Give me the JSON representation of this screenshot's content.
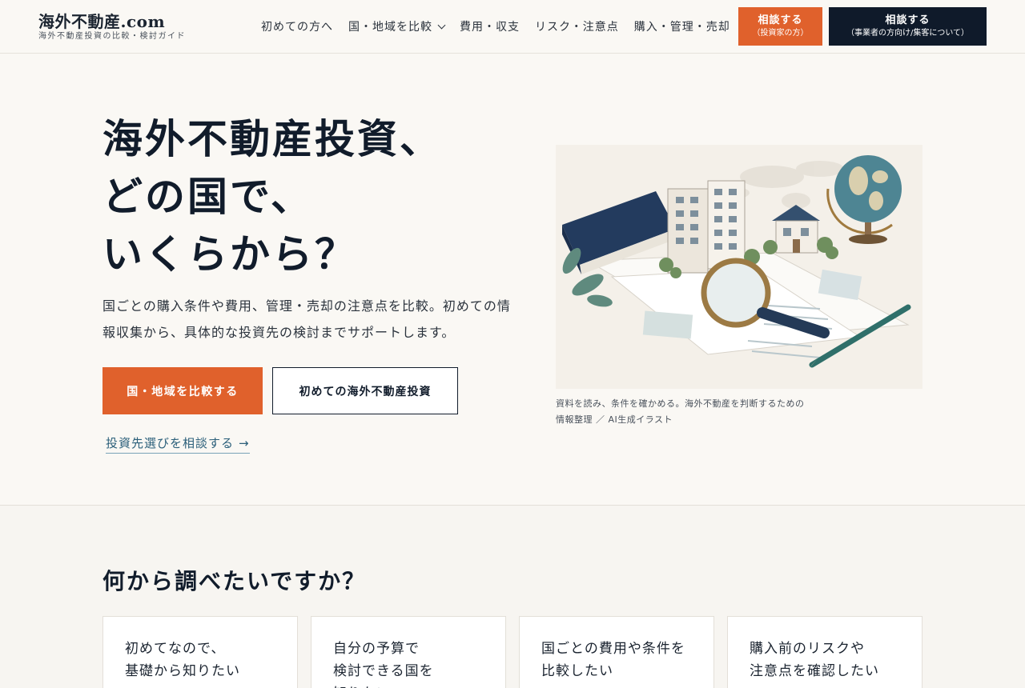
{
  "header": {
    "logo_title": "海外不動産.com",
    "logo_subtitle": "海外不動産投資の比較・検討ガイド",
    "nav": [
      {
        "label": "初めての方へ"
      },
      {
        "label": "国・地域を比較",
        "has_dropdown": true
      },
      {
        "label": "費用・収支"
      },
      {
        "label": "リスク・注意点"
      },
      {
        "label": "購入・管理・売却"
      }
    ],
    "consult_investor": {
      "line1": "相談する",
      "line2": "（投資家の方）"
    },
    "consult_business": {
      "line1": "相談する",
      "line2": "（事業者の方向け/集客について）"
    }
  },
  "hero": {
    "title_lines": [
      "海外不動産投資、",
      "どの国で、",
      "いくらから？"
    ],
    "description": "国ごとの購入条件や費用、管理・売却の注意点を比較。初めての情報収集から、具体的な投資先の検討までサポートします。",
    "primary_button": "国・地域を比較する",
    "secondary_button": "初めての海外不動産投資",
    "consult_link": "投資先選びを相談する",
    "consult_link_arrow": "→",
    "image_caption_line1": "資料を読み、条件を確かめる。海外不動産を判断するための",
    "image_caption_line2": "情報整理 ／ AI生成イラスト"
  },
  "section2": {
    "title": "何から調べたいですか？",
    "cards": [
      {
        "text": "初めてなので、\n基礎から知りたい"
      },
      {
        "text": "自分の予算で\n検討できる国を\n知りたい"
      },
      {
        "text": "国ごとの費用や条件を\n比較したい"
      },
      {
        "text": "購入前のリスクや\n注意点を確認したい"
      }
    ]
  },
  "colors": {
    "accent": "#e0612c",
    "navy": "#0f1a2a",
    "link": "#2b5f7a",
    "background": "#faf8f4"
  }
}
